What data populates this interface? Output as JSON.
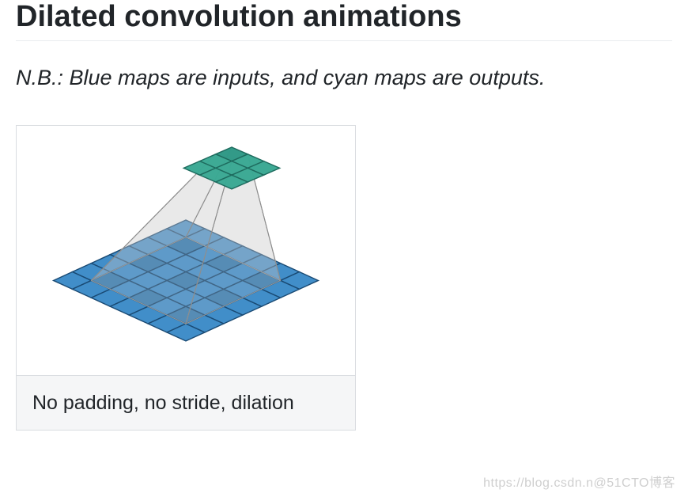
{
  "title": "Dilated convolution animations",
  "note": "N.B.: Blue maps are inputs, and cyan maps are outputs.",
  "figure": {
    "caption": "No padding, no stride, dilation",
    "alt": "dilated-convolution-figure",
    "input_grid": {
      "size": 7,
      "fill": "#3989c7",
      "dark_fill": "#2e76ad",
      "stroke": "#1a4a73",
      "dark_cells": [
        [
          1,
          1
        ],
        [
          1,
          3
        ],
        [
          1,
          5
        ],
        [
          3,
          1
        ],
        [
          3,
          3
        ],
        [
          3,
          5
        ],
        [
          5,
          1
        ],
        [
          5,
          3
        ],
        [
          5,
          5
        ]
      ]
    },
    "output_grid": {
      "size": 3,
      "fill": "#3aa893",
      "dark_fill": "#2f9886",
      "stroke": "#1e6b5e",
      "dark_cells": [
        [
          0,
          0
        ]
      ]
    }
  },
  "watermark": "https://blog.csdn.n@51CTO博客"
}
